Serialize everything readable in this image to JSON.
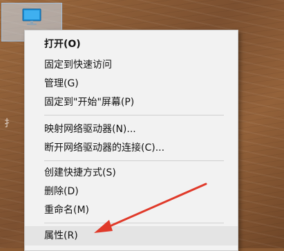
{
  "desktop": {
    "icon": "this-pc-icon"
  },
  "context_menu": {
    "items": [
      {
        "label": "打开(O)"
      },
      {
        "label": "固定到快速访问"
      },
      {
        "label": "管理(G)"
      },
      {
        "label": "固定到\"开始\"屏幕(P)"
      },
      {
        "label": "映射网络驱动器(N)..."
      },
      {
        "label": "断开网络驱动器的连接(C)..."
      },
      {
        "label": "创建快捷方式(S)"
      },
      {
        "label": "删除(D)"
      },
      {
        "label": "重命名(M)"
      },
      {
        "label": "属性(R)"
      }
    ]
  },
  "annotation": {
    "color": "#e03a2a",
    "icon": "red-arrow-pointer"
  }
}
